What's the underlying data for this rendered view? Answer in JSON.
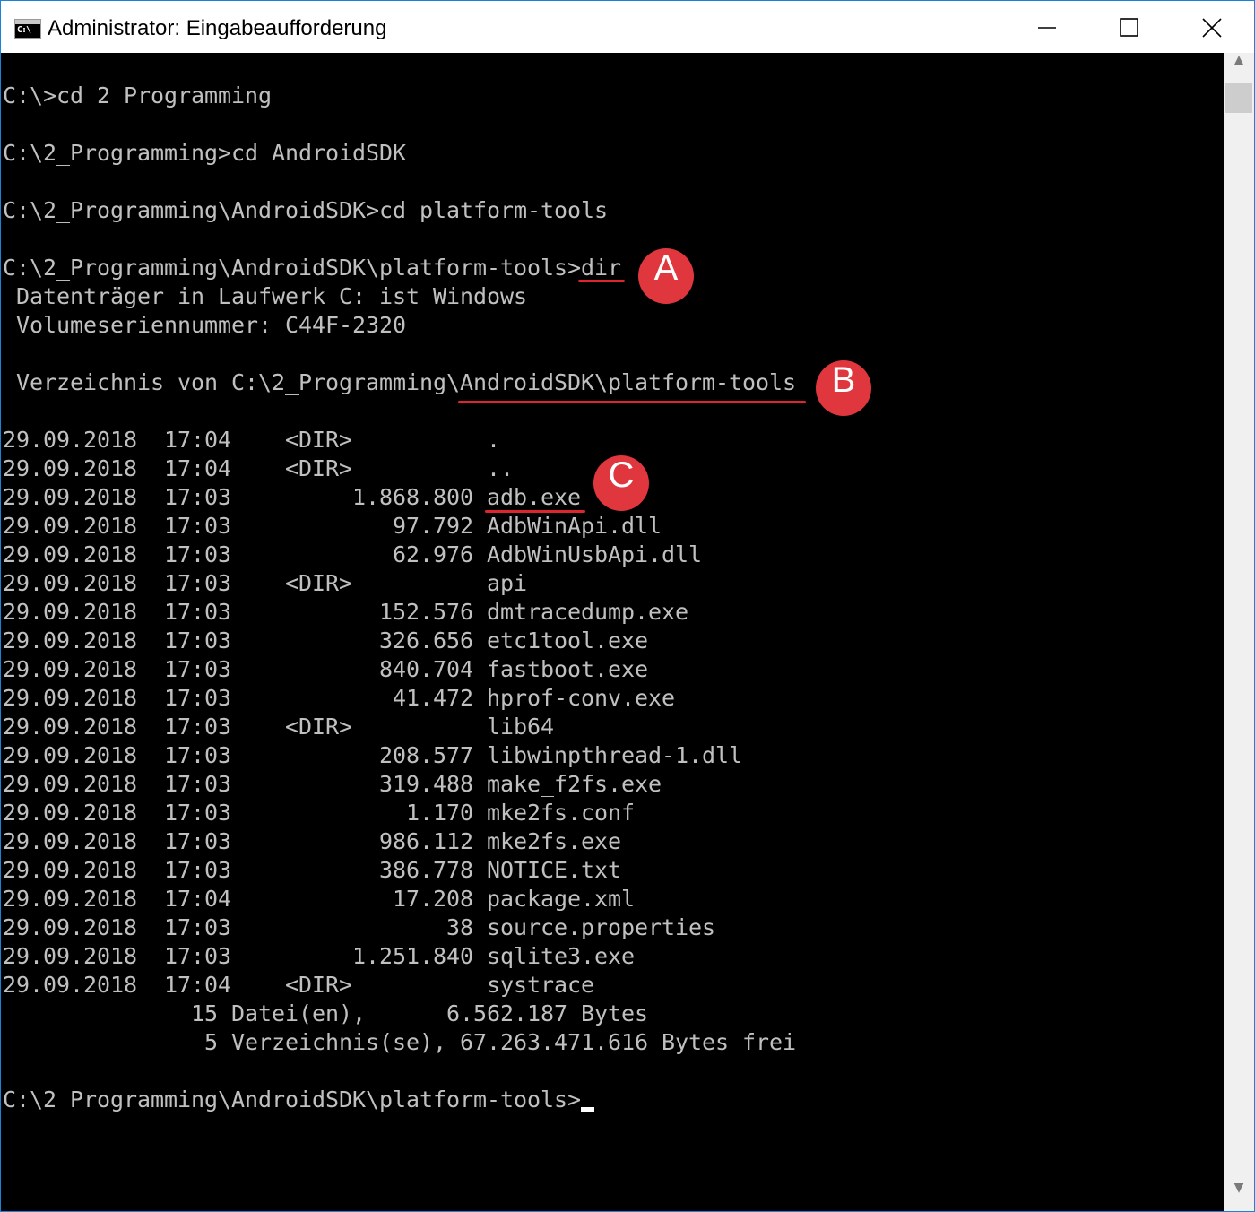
{
  "window": {
    "title": "Administrator: Eingabeaufforderung",
    "icon_text": "C:\\",
    "icon": "cmd-icon"
  },
  "controls": {
    "minimize": "minimize-icon",
    "maximize": "maximize-icon",
    "close": "close-icon"
  },
  "console": {
    "lines": [
      "",
      "C:\\>cd 2_Programming",
      "",
      "C:\\2_Programming>cd AndroidSDK",
      "",
      "C:\\2_Programming\\AndroidSDK>cd platform-tools",
      "",
      "C:\\2_Programming\\AndroidSDK\\platform-tools>dir",
      " Datenträger in Laufwerk C: ist Windows",
      " Volumeseriennummer: C44F-2320",
      "",
      " Verzeichnis von C:\\2_Programming\\AndroidSDK\\platform-tools",
      "",
      "29.09.2018  17:04    <DIR>          .",
      "29.09.2018  17:04    <DIR>          ..",
      "29.09.2018  17:03         1.868.800 adb.exe",
      "29.09.2018  17:03            97.792 AdbWinApi.dll",
      "29.09.2018  17:03            62.976 AdbWinUsbApi.dll",
      "29.09.2018  17:03    <DIR>          api",
      "29.09.2018  17:03           152.576 dmtracedump.exe",
      "29.09.2018  17:03           326.656 etc1tool.exe",
      "29.09.2018  17:03           840.704 fastboot.exe",
      "29.09.2018  17:03            41.472 hprof-conv.exe",
      "29.09.2018  17:03    <DIR>          lib64",
      "29.09.2018  17:03           208.577 libwinpthread-1.dll",
      "29.09.2018  17:03           319.488 make_f2fs.exe",
      "29.09.2018  17:03             1.170 mke2fs.conf",
      "29.09.2018  17:03           986.112 mke2fs.exe",
      "29.09.2018  17:03           386.778 NOTICE.txt",
      "29.09.2018  17:04            17.208 package.xml",
      "29.09.2018  17:03                38 source.properties",
      "29.09.2018  17:03         1.251.840 sqlite3.exe",
      "29.09.2018  17:04    <DIR>          systrace",
      "              15 Datei(en),      6.562.187 Bytes",
      "               5 Verzeichnis(se), 67.263.471.616 Bytes frei",
      "",
      "C:\\2_Programming\\AndroidSDK\\platform-tools>"
    ],
    "text_color": "#c0c0c0",
    "background": "#000000"
  },
  "annotations": {
    "a": "A",
    "b": "B",
    "c": "C",
    "color": "#e0363d"
  },
  "scrollbar": {
    "up_icon": "scroll-up-arrow-icon",
    "down_icon": "scroll-down-arrow-icon"
  }
}
